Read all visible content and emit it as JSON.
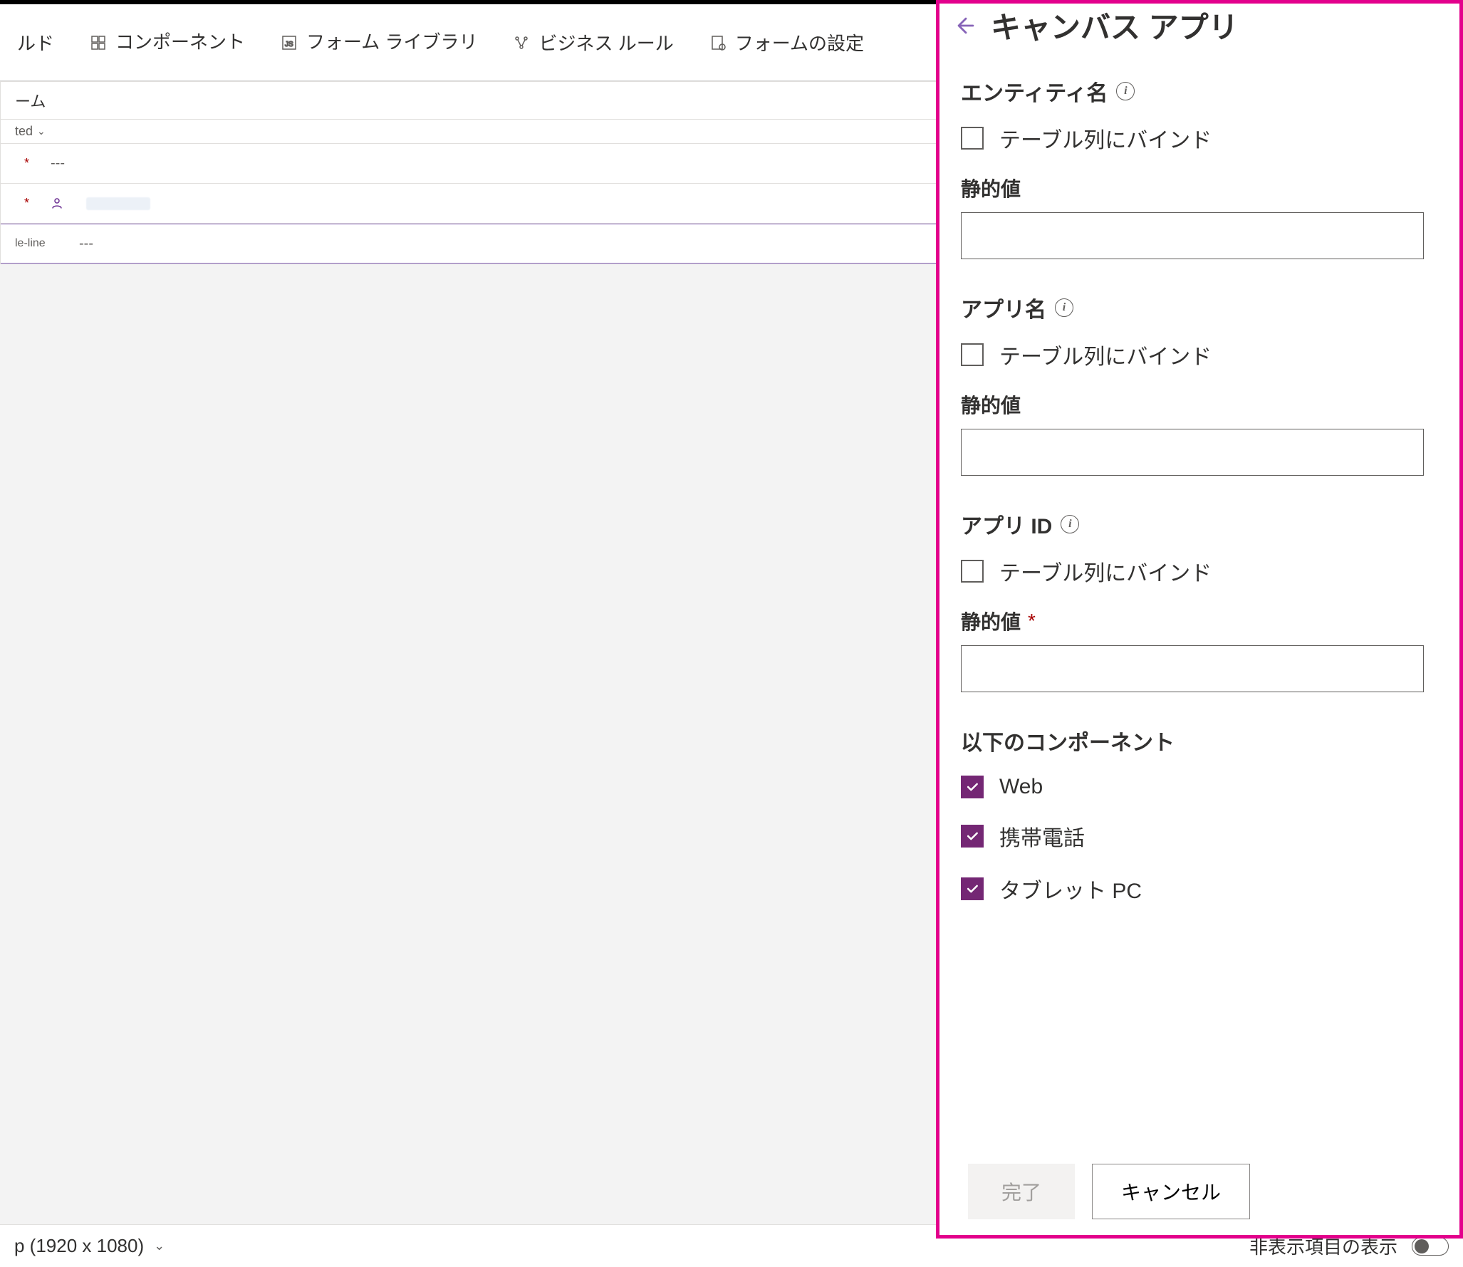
{
  "toolbar": {
    "field": "ルド",
    "component": "コンポーネント",
    "formLibrary": "フォーム ライブラリ",
    "businessRule": "ビジネス ルール",
    "formSettings": "フォームの設定"
  },
  "form": {
    "headerSuffix": "ーム",
    "relatedSuffix": "ted",
    "placeholder": "---",
    "rowLabel": "le-line"
  },
  "panel": {
    "title": "キャンバス アプリ",
    "entityName": {
      "label": "エンティティ名",
      "bindToColumn": "テーブル列にバインド",
      "staticValueLabel": "静的値"
    },
    "appName": {
      "label": "アプリ名",
      "bindToColumn": "テーブル列にバインド",
      "staticValueLabel": "静的値"
    },
    "appId": {
      "label": "アプリ ID",
      "bindToColumn": "テーブル列にバインド",
      "staticValueLabel": "静的値"
    },
    "componentsHeading": "以下のコンポーネント",
    "components": {
      "web": "Web",
      "phone": "携帯電話",
      "tablet": "タブレット PC"
    },
    "doneButton": "完了",
    "cancelButton": "キャンセル"
  },
  "statusBar": {
    "resolution": "p (1920 x 1080)",
    "hiddenItems": "非表示項目の表示"
  }
}
